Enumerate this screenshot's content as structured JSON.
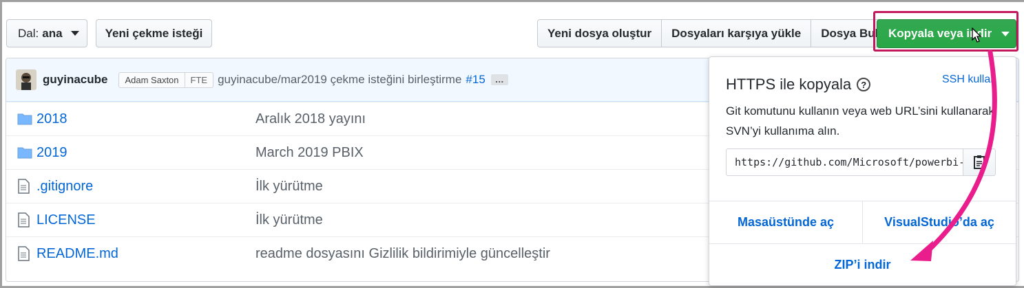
{
  "toolbar": {
    "branch_label": "Dal:",
    "branch_value": "ana",
    "new_pr": "Yeni çekme isteği",
    "create_file": "Yeni dosya oluştur",
    "upload_files": "Dosyaları karşıya yükle",
    "find_file": "Dosya Bul",
    "clone_download": "Kopyala veya indir"
  },
  "commit": {
    "user": "guyinacube",
    "coauthor": "Adam Saxton",
    "badge": "FTE",
    "message": "guyinacube/mar2019 çekme isteğini birleştirme",
    "pr_link": "#15",
    "ellipsis": "…"
  },
  "files": [
    {
      "name": "2018",
      "message": "Aralık 2018 yayını",
      "icon": "folder-icon"
    },
    {
      "name": "2019",
      "message": "March 2019 PBIX",
      "icon": "folder-icon"
    },
    {
      "name": ".gitignore",
      "message": "İlk yürütme",
      "icon": "file-icon"
    },
    {
      "name": "LICENSE",
      "message": "İlk yürütme",
      "icon": "file-icon"
    },
    {
      "name": "README.md",
      "message": "readme dosyasını Gizlilik bildirimiyle güncelleştir",
      "icon": "file-icon"
    }
  ],
  "dropdown": {
    "title": "HTTPS ile kopyala",
    "ssh_link": "SSH kullan",
    "description": "Git komutunu kullanın veya web URL’sini kullanarak SVN’yi kullanıma alın.",
    "url": "https://github.com/Microsoft/powerbi-desktop-samples.git",
    "open_desktop": "Masaüstünde aç",
    "open_vs": "VisualStudio’da aç",
    "download_zip": "ZIP’i indir"
  },
  "colors": {
    "link": "#0366d6",
    "primary_green": "#28a745",
    "annotation_magenta": "#e91e8c",
    "highlight_border": "#c2185b"
  }
}
